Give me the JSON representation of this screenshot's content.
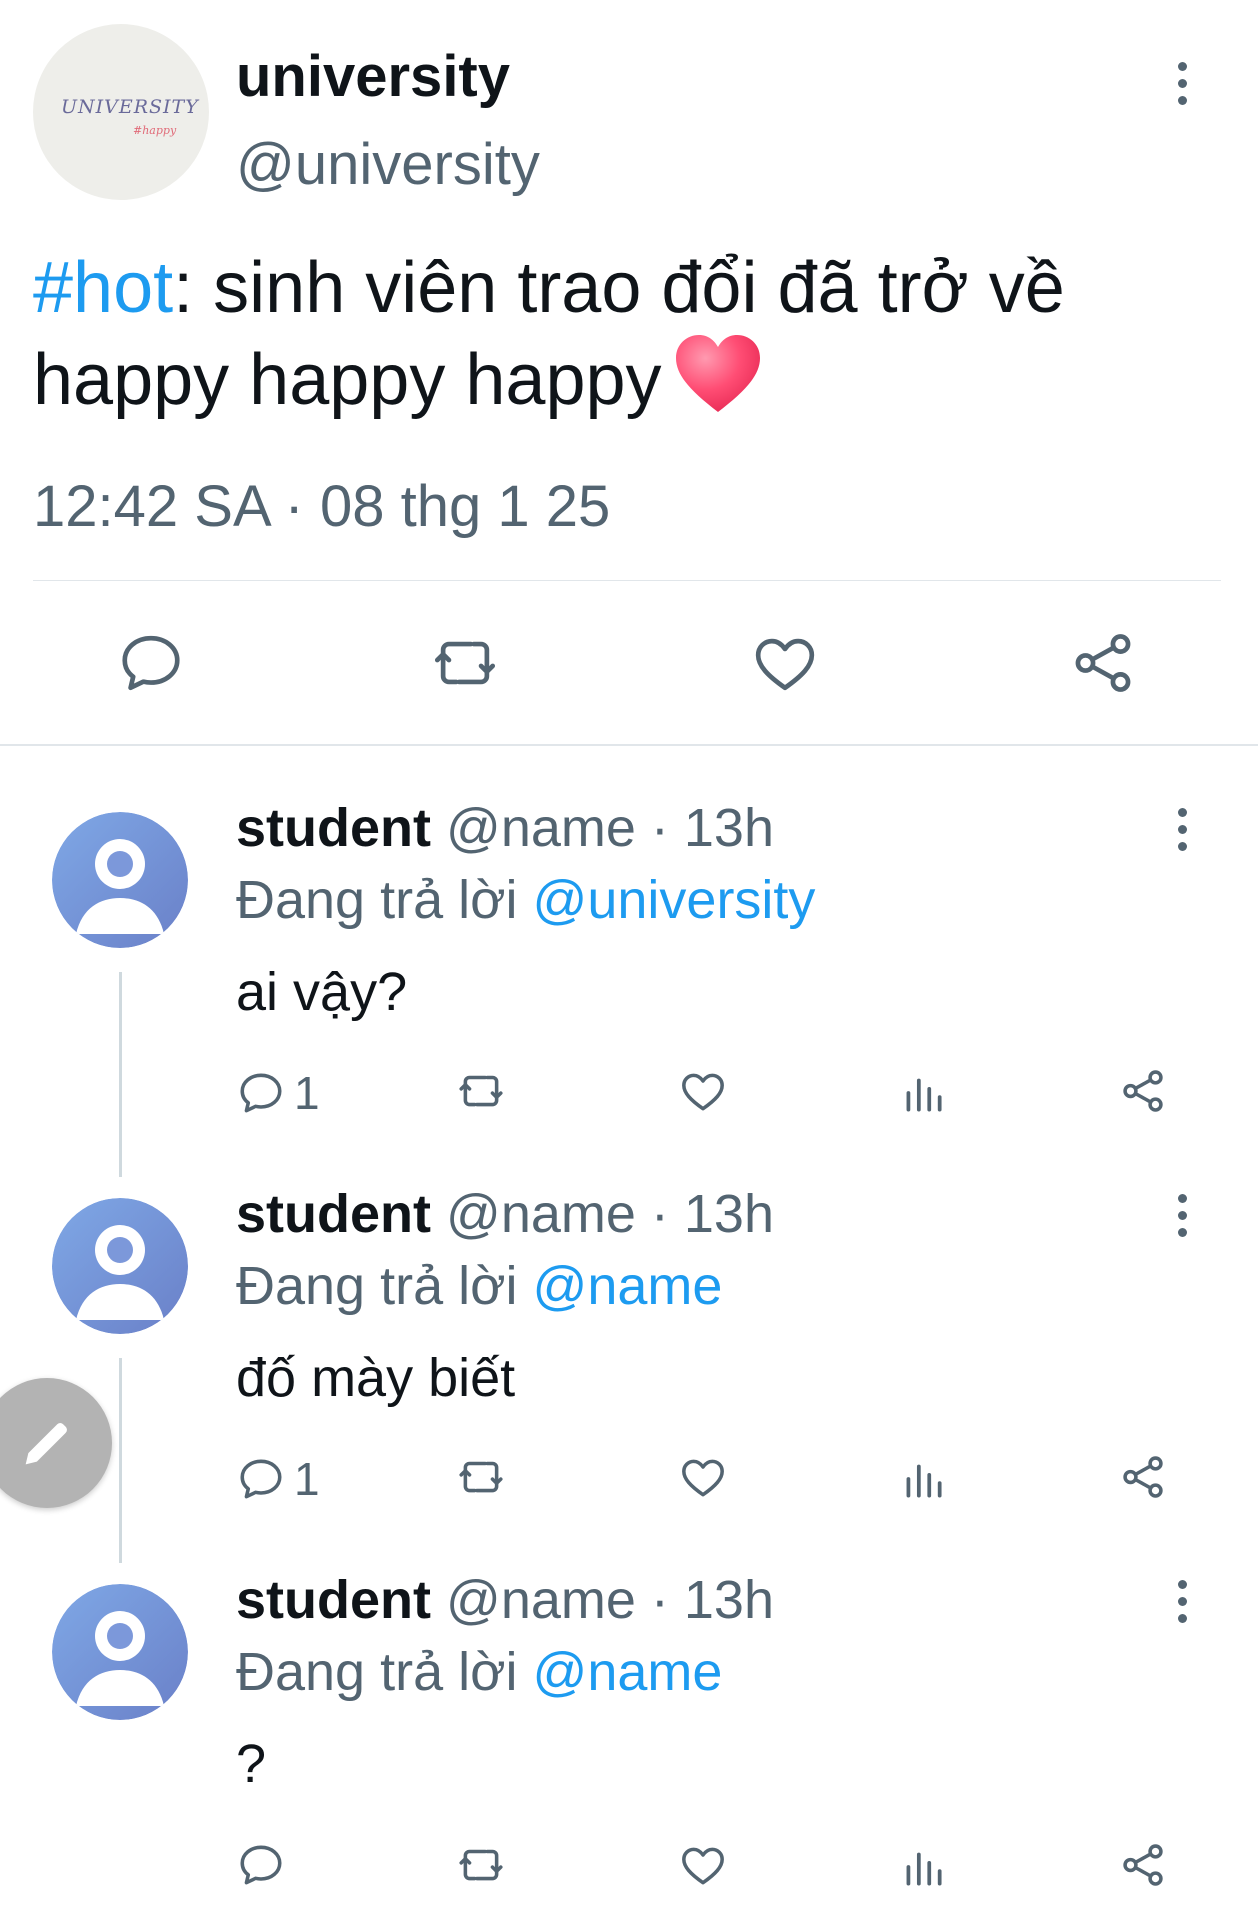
{
  "main_tweet": {
    "avatar_logo_text": "UNIVERSITY",
    "avatar_logo_sub": "#happy",
    "display_name": "university",
    "handle": "@university",
    "hashtag": "#hot",
    "text_after_hashtag": ": sinh viên trao đổi đã trở về happy happy happy",
    "timestamp": "12:42 SA · 08 thg 1 25",
    "actions": [
      "reply-icon",
      "retweet-icon",
      "like-icon",
      "share-icon"
    ]
  },
  "replies": [
    {
      "name": "student",
      "handle_time": " @name · 13h",
      "replying_prefix": "Đang trả lời ",
      "replying_to": "@university",
      "text": "ai vậy?",
      "reply_count": "1"
    },
    {
      "name": "student",
      "handle_time": " @name · 13h",
      "replying_prefix": "Đang trả lời ",
      "replying_to": "@name",
      "text": "đố mày biết",
      "reply_count": "1"
    },
    {
      "name": "student",
      "handle_time": " @name · 13h",
      "replying_prefix": "Đang trả lời ",
      "replying_to": "@name",
      "text": "?",
      "reply_count": ""
    }
  ],
  "colors": {
    "accent": "#1d9bf0",
    "secondary_text": "#536471",
    "avatar_gradient_start": "#7fa8e6",
    "avatar_gradient_end": "#6a80c8",
    "fab": "#b3b3b3"
  },
  "fab_icon": "pencil-icon"
}
